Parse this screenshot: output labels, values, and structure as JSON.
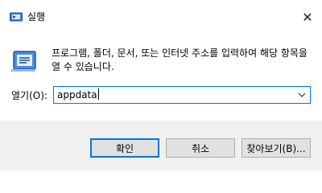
{
  "window": {
    "title": "실행",
    "close_glyph": "✕"
  },
  "body": {
    "description": "프로그램, 폴더, 문서, 또는 인터넷 주소를 입력하여 해당 항목을 열 수 있습니다.",
    "open_label": "열기(O):",
    "open_value": "appdata"
  },
  "buttons": {
    "ok_label": "확인",
    "cancel_label": "취소",
    "browse_label": "찾아보기(B)..."
  },
  "icons": {
    "title": "run-icon",
    "main": "run-icon",
    "dropdown": "chevron-down-icon",
    "close": "close-icon"
  },
  "colors": {
    "accent": "#0078d7",
    "footer_bg": "#f0f0f0",
    "button_bg": "#e1e1e1"
  }
}
